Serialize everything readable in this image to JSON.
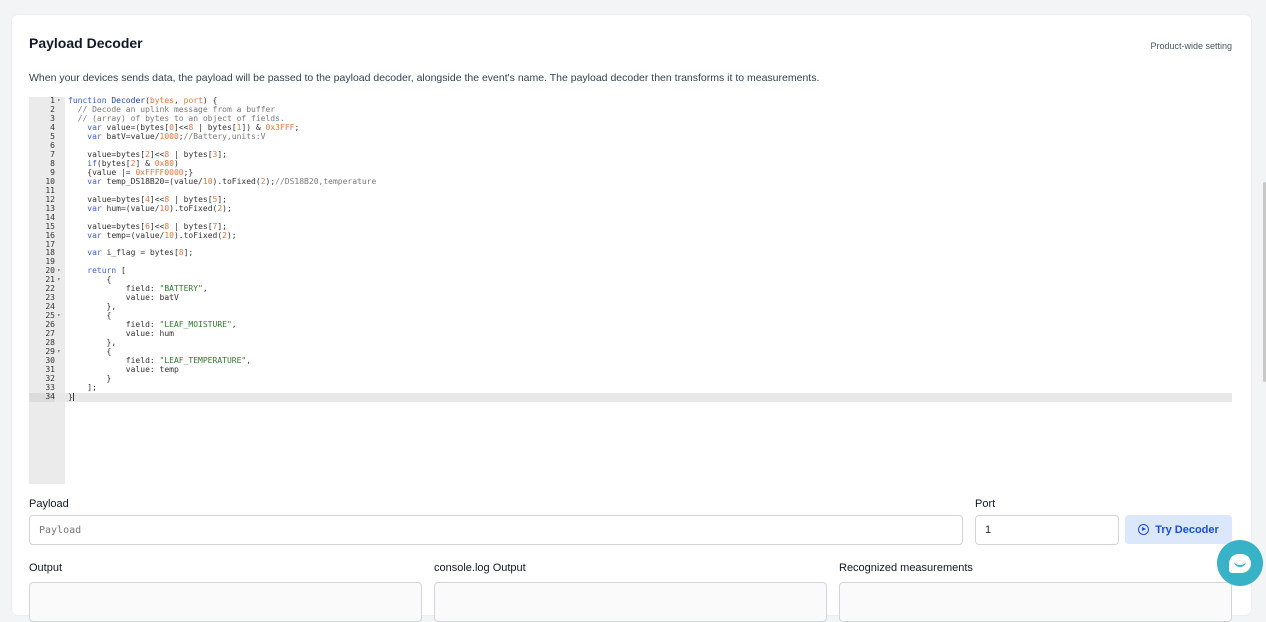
{
  "header": {
    "title": "Payload Decoder",
    "scope": "Product-wide setting",
    "description": "When your devices sends data, the payload will be passed to the payload decoder, alongside the event's name. The payload decoder then transforms it to measurements."
  },
  "editor": {
    "active_line": 34,
    "lines": [
      {
        "n": "1",
        "fold": true,
        "html": "<span class='kw'>function</span> <span class='fn'>Decoder</span>(<span class='num'>bytes</span>, <span class='num'>port</span>) {"
      },
      {
        "n": "2",
        "html": "  <span class='cm'>// Decode an uplink message from a buffer</span>"
      },
      {
        "n": "3",
        "html": "  <span class='cm'>// (array) of bytes to an object of fields.</span>"
      },
      {
        "n": "4",
        "html": "    <span class='kw'>var</span> value=(bytes[<span class='num'>0</span>]&lt;&lt;<span class='num'>8</span> | bytes[<span class='num'>1</span>]) &amp; <span class='num'>0x3FFF</span>;"
      },
      {
        "n": "5",
        "html": "    <span class='kw'>var</span> batV=value/<span class='num'>1000</span>;<span class='cm'>//Battery,units:V</span>"
      },
      {
        "n": "6",
        "html": ""
      },
      {
        "n": "7",
        "html": "    value=bytes[<span class='num'>2</span>]&lt;&lt;<span class='num'>8</span> | bytes[<span class='num'>3</span>];"
      },
      {
        "n": "8",
        "html": "    <span class='kw'>if</span>(bytes[<span class='num'>2</span>] &amp; <span class='num'>0x80</span>)"
      },
      {
        "n": "9",
        "html": "    {value |= <span class='num'>0xFFFF0000</span>;}"
      },
      {
        "n": "10",
        "html": "    <span class='kw'>var</span> temp_DS18B20=(value/<span class='num'>10</span>).toFixed(<span class='num'>2</span>);<span class='cm'>//DS18B20,temperature</span>"
      },
      {
        "n": "11",
        "html": ""
      },
      {
        "n": "12",
        "html": "    value=bytes[<span class='num'>4</span>]&lt;&lt;<span class='num'>8</span> | bytes[<span class='num'>5</span>];"
      },
      {
        "n": "13",
        "html": "    <span class='kw'>var</span> hum=(value/<span class='num'>10</span>).toFixed(<span class='num'>2</span>);"
      },
      {
        "n": "14",
        "html": ""
      },
      {
        "n": "15",
        "html": "    value=bytes[<span class='num'>6</span>]&lt;&lt;<span class='num'>8</span> | bytes[<span class='num'>7</span>];"
      },
      {
        "n": "16",
        "html": "    <span class='kw'>var</span> temp=(value/<span class='num'>10</span>).toFixed(<span class='num'>2</span>);"
      },
      {
        "n": "17",
        "html": ""
      },
      {
        "n": "18",
        "html": "    <span class='kw'>var</span> i_flag = bytes[<span class='num'>8</span>];"
      },
      {
        "n": "19",
        "html": ""
      },
      {
        "n": "20",
        "fold": true,
        "html": "    <span class='kw'>return</span> ["
      },
      {
        "n": "21",
        "fold": true,
        "html": "        {"
      },
      {
        "n": "22",
        "html": "            field: <span class='str'>\"BATTERY\"</span>,"
      },
      {
        "n": "23",
        "html": "            value: batV"
      },
      {
        "n": "24",
        "html": "        },"
      },
      {
        "n": "25",
        "fold": true,
        "html": "        {"
      },
      {
        "n": "26",
        "html": "            field: <span class='str'>\"LEAF_MOISTURE\"</span>,"
      },
      {
        "n": "27",
        "html": "            value: hum"
      },
      {
        "n": "28",
        "html": "        },"
      },
      {
        "n": "29",
        "fold": true,
        "html": "        {"
      },
      {
        "n": "30",
        "html": "            field: <span class='str'>\"LEAF_TEMPERATURE\"</span>,"
      },
      {
        "n": "31",
        "html": "            value: temp"
      },
      {
        "n": "32",
        "html": "        }"
      },
      {
        "n": "33",
        "html": "    ];"
      },
      {
        "n": "34",
        "html": "}<span class='cursor'></span>"
      }
    ]
  },
  "payload": {
    "label": "Payload",
    "placeholder": "Payload",
    "value": ""
  },
  "port": {
    "label": "Port",
    "value": "1"
  },
  "try_button": {
    "label": "Try Decoder",
    "icon": "play-circle-icon"
  },
  "outputs": {
    "output_label": "Output",
    "console_label": "console.log Output",
    "measurements_label": "Recognized measurements"
  },
  "colors": {
    "accent": "#1d4ed8",
    "button_bg": "#dbe7fb",
    "chat": "#38b2c7"
  }
}
